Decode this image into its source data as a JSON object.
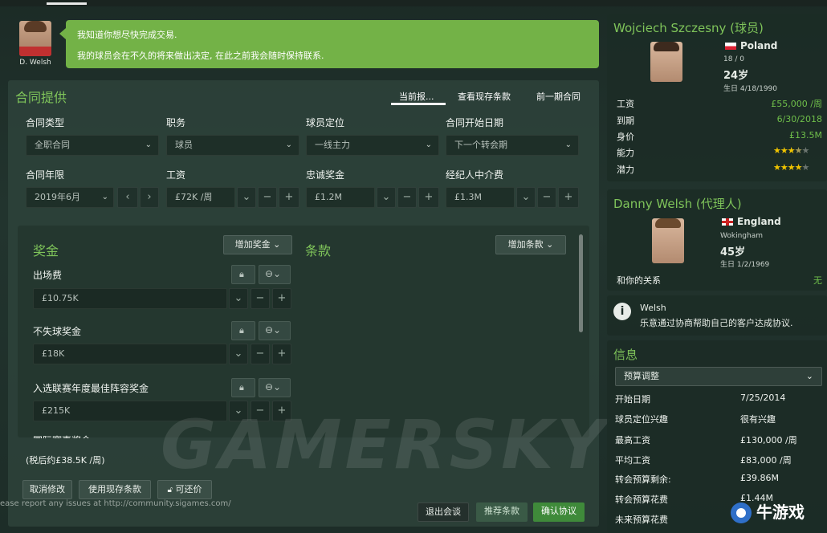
{
  "agent": {
    "name": "D. Welsh"
  },
  "message": {
    "line1": "我知道你想尽快完成交易.",
    "line2": "我的球员会在不久的将来做出决定, 在此之前我会随时保持联系."
  },
  "contract": {
    "title": "合同提供",
    "tabs": [
      "当前报...",
      "查看现存条款",
      "前一期合同"
    ],
    "fields": {
      "type": {
        "label": "合同类型",
        "value": "全职合同"
      },
      "role": {
        "label": "职务",
        "value": "球员"
      },
      "status": {
        "label": "球员定位",
        "value": "一线主力"
      },
      "start": {
        "label": "合同开始日期",
        "value": "下一个转会期"
      },
      "length": {
        "label": "合同年限",
        "value": "2019年6月"
      },
      "wage": {
        "label": "工资",
        "value": "£72K /周"
      },
      "loyalty": {
        "label": "忠诚奖金",
        "value": "£1.2M"
      },
      "agent_fee": {
        "label": "经纪人中介费",
        "value": "£1.3M"
      }
    },
    "bonus": {
      "title": "奖金",
      "add_label": "增加奖金",
      "items": [
        {
          "label": "出场费",
          "value": "£10.75K"
        },
        {
          "label": "不失球奖金",
          "value": "£18K"
        },
        {
          "label": "入选联赛年度最佳阵容奖金",
          "value": "£215K"
        },
        {
          "label": "国际赛事奖金",
          "value": ""
        }
      ]
    },
    "clauses": {
      "title": "条款",
      "add_label": "增加条款"
    },
    "after_tax": "(税后约£38.5K /周)",
    "buttons": {
      "cancel": "取消修改",
      "use_existing": "使用现存条款",
      "counter": "可还价"
    },
    "actions": {
      "exit": "退出会谈",
      "suggest": "推荐条款",
      "confirm": "确认协议"
    }
  },
  "report_text": "ease report any issues at http://community.sigames.com/",
  "watermark": "GAMERSKY",
  "player": {
    "name": "Wojciech Szczesny (球员)",
    "nation": "Poland",
    "caps": "18 / 0",
    "age": "24岁",
    "born": "生日 4/18/1990",
    "rows": [
      {
        "label": "工资",
        "value": "£55,000 /周"
      },
      {
        "label": "到期",
        "value": "6/30/2018"
      },
      {
        "label": "身价",
        "value": "£13.5M"
      }
    ],
    "ability_label": "能力",
    "ability_stars": 3.5,
    "potential_label": "潜力",
    "potential_stars": 4
  },
  "agent_panel": {
    "name": "Danny Welsh (代理人)",
    "nation": "England",
    "city": "Wokingham",
    "age": "45岁",
    "born": "生日 1/2/1969",
    "relation_label": "和你的关系",
    "relation_value": "无"
  },
  "note": {
    "title": "Welsh",
    "text": "乐意通过协商帮助自己的客户达成协议."
  },
  "info": {
    "title": "信息",
    "dropdown": "预算调整",
    "rows": [
      {
        "label": "开始日期",
        "value": "7/25/2014"
      },
      {
        "label": "球员定位兴趣",
        "value": "很有兴趣"
      },
      {
        "label": "最高工资",
        "value": "£130,000 /周"
      },
      {
        "label": "平均工资",
        "value": "£83,000 /周"
      },
      {
        "label": "转会预算剩余:",
        "value": "£39.86M"
      },
      {
        "label": "转会预算花费",
        "value": "£1.44M"
      },
      {
        "label": "未来预算花费",
        "value": ""
      }
    ]
  },
  "logo_text": "牛游戏",
  "colors": {
    "accent": "#7fc45a",
    "bubble": "#73b247",
    "confirm": "#3f8a3a"
  }
}
